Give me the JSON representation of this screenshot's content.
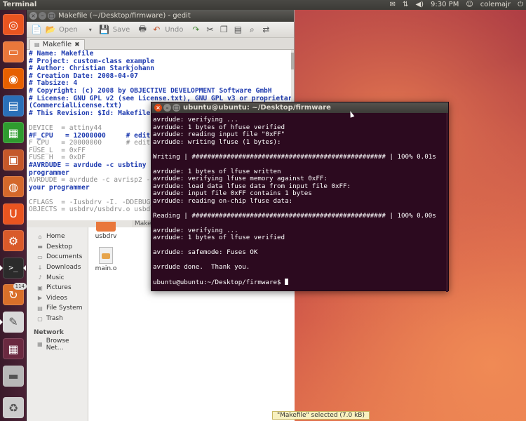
{
  "top_panel": {
    "app_title": "Terminal",
    "time": "9:30 PM",
    "user": "colemajr",
    "icons": [
      "mail-icon",
      "network-icon",
      "volume-icon",
      "user-icon",
      "power-icon"
    ]
  },
  "launcher": {
    "items": [
      {
        "name": "dash-icon",
        "glyph": "◎",
        "color": "#e95420"
      },
      {
        "name": "files-icon",
        "glyph": "▭",
        "color": "#e9773b"
      },
      {
        "name": "firefox-icon",
        "glyph": "◉",
        "color": "#e66000"
      },
      {
        "name": "writer-icon",
        "glyph": "▤",
        "color": "#2a6fb8"
      },
      {
        "name": "calc-icon",
        "glyph": "▦",
        "color": "#2f9b2f"
      },
      {
        "name": "impress-icon",
        "glyph": "▣",
        "color": "#c4582a"
      },
      {
        "name": "software-center-icon",
        "glyph": "◍",
        "color": "#d4682b"
      },
      {
        "name": "ubuntu-one-icon",
        "glyph": "U",
        "color": "#e95420"
      },
      {
        "name": "settings-icon",
        "glyph": "⚙",
        "color": "#d95a2a"
      },
      {
        "name": "terminal-icon",
        "glyph": ">_",
        "color": "#2b2b2b"
      },
      {
        "name": "update-manager-icon",
        "glyph": "↻",
        "color": "#d96f2a",
        "badge": "114"
      },
      {
        "name": "gedit-icon",
        "glyph": "✎",
        "color": "#d9d9d9"
      },
      {
        "name": "workspaces-icon",
        "glyph": "▦",
        "color": "#6a2940"
      },
      {
        "name": "removable-drive-icon",
        "glyph": "▬",
        "color": "#b8b8b8"
      },
      {
        "name": "trash-icon",
        "glyph": "♻",
        "color": "#cccccc"
      }
    ]
  },
  "gedit": {
    "title": "Makefile (~/Desktop/firmware) - gedit",
    "toolbar": {
      "open": "Open",
      "save": "Save",
      "undo": "Undo"
    },
    "tab": "Makefile",
    "lines": [
      {
        "t": "# Name: Makefile",
        "s": "c"
      },
      {
        "t": "# Project: custom-class example",
        "s": "c"
      },
      {
        "t": "# Author: Christian Starkjohann",
        "s": "c"
      },
      {
        "t": "# Creation Date: 2008-04-07",
        "s": "c"
      },
      {
        "t": "# Tabsize: 4",
        "s": "c"
      },
      {
        "t": "# Copyright: (c) 2008 by OBJECTIVE DEVELOPMENT Software GmbH",
        "s": "c"
      },
      {
        "t": "# License: GNU GPL v2 (see License.txt), GNU GPL v3 or proprietary",
        "s": "c"
      },
      {
        "t": "(CommercialLicense.txt)",
        "s": "c"
      },
      {
        "t": "# This Revision: $Id: Makefile 69",
        "s": "c"
      },
      {
        "t": "",
        "s": "k"
      },
      {
        "t": "DEVICE  = attiny44",
        "s": "k"
      },
      {
        "t": "#F_CPU   = 12000000     # edit th",
        "s": "v"
      },
      {
        "t": "F_CPU   = 20000000      # edit th",
        "s": "k"
      },
      {
        "t": "FUSE_L  = 0xFF",
        "s": "k"
      },
      {
        "t": "FUSE_H  = 0xDF",
        "s": "k"
      },
      {
        "t": "#AVRDUDE = avrdude -c usbtiny -p",
        "s": "v"
      },
      {
        "t": "programmer",
        "s": "v"
      },
      {
        "t": "AVRDUDE = avrdude -c avrisp2 -P v",
        "s": "k"
      },
      {
        "t": "your programmer",
        "s": "v"
      },
      {
        "t": "",
        "s": "k"
      },
      {
        "t": "CFLAGS  = -Iusbdrv -I. -DDEBUG_LE",
        "s": "k"
      },
      {
        "t": "OBJECTS = usbdrv/usbdrv.o usbdrv/",
        "s": "k"
      }
    ],
    "bottom_tab": "Makefile"
  },
  "nautilus": {
    "places": [
      {
        "label": "Home",
        "icon": "home-icon",
        "glyph": "⌂"
      },
      {
        "label": "Desktop",
        "icon": "desktop-icon",
        "glyph": "▬"
      },
      {
        "label": "Documents",
        "icon": "documents-icon",
        "glyph": "▭"
      },
      {
        "label": "Downloads",
        "icon": "downloads-icon",
        "glyph": "↓"
      },
      {
        "label": "Music",
        "icon": "music-icon",
        "glyph": "♪"
      },
      {
        "label": "Pictures",
        "icon": "pictures-icon",
        "glyph": "▣"
      },
      {
        "label": "Videos",
        "icon": "videos-icon",
        "glyph": "▶"
      },
      {
        "label": "File System",
        "icon": "filesystem-icon",
        "glyph": "▤"
      },
      {
        "label": "Trash",
        "icon": "trash-icon",
        "glyph": "▢"
      }
    ],
    "network_heading": "Network",
    "network_items": [
      {
        "label": "Browse Net…",
        "icon": "network-icon",
        "glyph": "▦"
      }
    ],
    "files": [
      {
        "label": "usbdrv",
        "kind": "folder"
      },
      {
        "label": "main.o",
        "kind": "doc"
      }
    ],
    "status": "\"Makefile\" selected (7.0 kB)"
  },
  "terminal": {
    "title": "ubuntu@ubuntu: ~/Desktop/firmware",
    "lines": [
      "avrdude: verifying ...",
      "avrdude: 1 bytes of hfuse verified",
      "avrdude: reading input file \"0xFF\"",
      "avrdude: writing lfuse (1 bytes):",
      "",
      "Writing | ################################################## | 100% 0.01s",
      "",
      "avrdude: 1 bytes of lfuse written",
      "avrdude: verifying lfuse memory against 0xFF:",
      "avrdude: load data lfuse data from input file 0xFF:",
      "avrdude: input file 0xFF contains 1 bytes",
      "avrdude: reading on-chip lfuse data:",
      "",
      "Reading | ################################################## | 100% 0.00s",
      "",
      "avrdude: verifying ...",
      "avrdude: 1 bytes of lfuse verified",
      "",
      "avrdude: safemode: Fuses OK",
      "",
      "avrdude done.  Thank you.",
      ""
    ],
    "prompt": "ubuntu@ubuntu:~/Desktop/firmware$ "
  }
}
